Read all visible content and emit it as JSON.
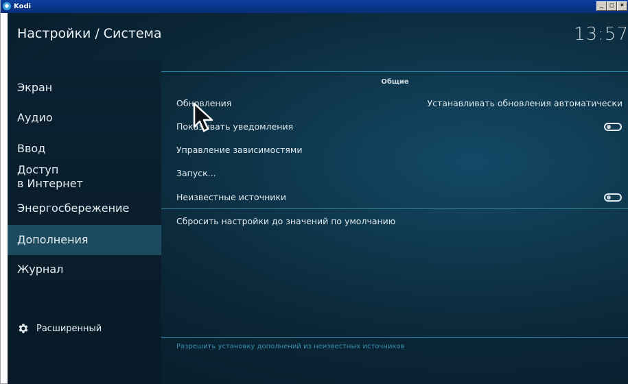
{
  "window": {
    "title": "Kodi",
    "icon": "kodi-logo-icon",
    "buttons": [
      "_",
      "□",
      "×"
    ]
  },
  "header": {
    "title": "Настройки / Система",
    "clock": "13:57"
  },
  "sidebar": {
    "items": [
      {
        "label": "Экран"
      },
      {
        "label": "Аудио"
      },
      {
        "label": "Ввод"
      },
      {
        "label": "Доступ\nв Интернет"
      },
      {
        "label": "Энергосбережение"
      },
      {
        "label": "Дополнения",
        "active": true
      },
      {
        "label": "Журнал"
      }
    ],
    "advanced_label": "Расширенный",
    "advanced_icon": "gear-icon"
  },
  "main": {
    "section_title": "Общие",
    "settings": [
      {
        "label": "Обновления",
        "value": "Устанавливать обновления автоматически"
      },
      {
        "label": "Показывать уведомления",
        "toggle": false
      },
      {
        "label": "Управление зависимостями"
      },
      {
        "label": "Запуск..."
      },
      {
        "label": "Неизвестные источники",
        "toggle": false
      },
      {
        "label": "Сбросить настройки до значений по умолчанию"
      }
    ],
    "hint": "Разрешить установку дополнений из неизвестных источников"
  },
  "colors": {
    "accent_line": "#2f87a8",
    "active_item": "#1c4a5e",
    "hint_text": "#3b8fae"
  }
}
